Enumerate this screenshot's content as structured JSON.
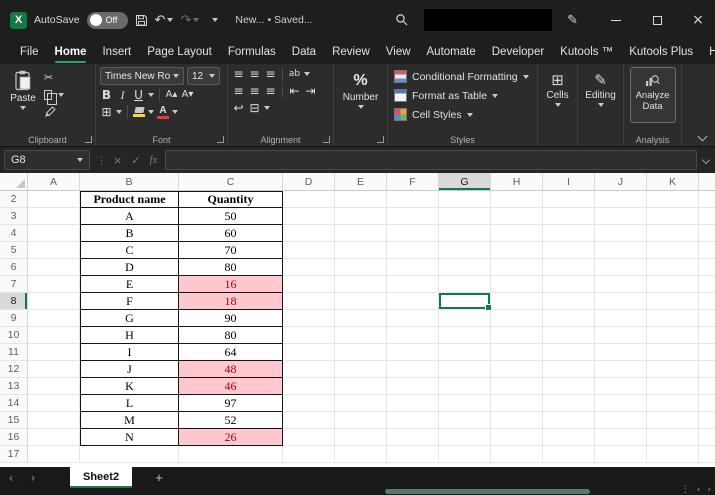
{
  "titlebar": {
    "autosave_label": "AutoSave",
    "autosave_state": "Off",
    "doc_status": "New... • Saved..."
  },
  "menu": {
    "items": [
      "File",
      "Home",
      "Insert",
      "Page Layout",
      "Formulas",
      "Data",
      "Review",
      "View",
      "Automate",
      "Developer",
      "Kutools ™",
      "Kutools Plus",
      "Help"
    ],
    "active": "Home"
  },
  "ribbon": {
    "paste": "Paste",
    "clipboard": "Clipboard",
    "font_name": "Times New Ro",
    "font_size": "12",
    "font": "Font",
    "bold": "B",
    "italic": "I",
    "underline": "U",
    "alignment": "Alignment",
    "number": "Number",
    "conditional_formatting": "Conditional Formatting",
    "format_as_table": "Format as Table",
    "cell_styles": "Cell Styles",
    "styles": "Styles",
    "cells": "Cells",
    "editing": "Editing",
    "analyze_data": "Analyze Data",
    "analysis": "Analysis"
  },
  "formula_bar": {
    "name_box": "G8",
    "fx_label": "fx",
    "formula_value": ""
  },
  "grid": {
    "columns": [
      "A",
      "B",
      "C",
      "D",
      "E",
      "F",
      "G",
      "H",
      "I",
      "J",
      "K"
    ],
    "rows": [
      2,
      3,
      4,
      5,
      6,
      7,
      8,
      9,
      10,
      11,
      12,
      13,
      14,
      15,
      16,
      17
    ],
    "selected_cell": "G8",
    "selected_column": "G",
    "selected_row": 8
  },
  "table": {
    "headers": [
      "Product name",
      "Quantity"
    ],
    "rows": [
      {
        "product": "A",
        "quantity": "50",
        "highlighted": false
      },
      {
        "product": "B",
        "quantity": "60",
        "highlighted": false
      },
      {
        "product": "C",
        "quantity": "70",
        "highlighted": false
      },
      {
        "product": "D",
        "quantity": "80",
        "highlighted": false
      },
      {
        "product": "E",
        "quantity": "16",
        "highlighted": true
      },
      {
        "product": "F",
        "quantity": "18",
        "highlighted": true
      },
      {
        "product": "G",
        "quantity": "90",
        "highlighted": false
      },
      {
        "product": "H",
        "quantity": "80",
        "highlighted": false
      },
      {
        "product": "I",
        "quantity": "64",
        "highlighted": false
      },
      {
        "product": "J",
        "quantity": "48",
        "highlighted": true
      },
      {
        "product": "K",
        "quantity": "46",
        "highlighted": true
      },
      {
        "product": "L",
        "quantity": "97",
        "highlighted": false
      },
      {
        "product": "M",
        "quantity": "52",
        "highlighted": false
      },
      {
        "product": "N",
        "quantity": "26",
        "highlighted": true
      }
    ]
  },
  "sheets": {
    "active": "Sheet2",
    "add_label": "+"
  },
  "icons": {
    "cut": "✂",
    "borders": "⊞",
    "align_lines": "≡",
    "indent_decrease": "⇤",
    "indent_increase": "⇥",
    "wrap_text": "↩",
    "merge_center": "⊟",
    "percent": "%",
    "cells_grid": "⊞",
    "editing_pencil": "✎",
    "pen": "✎",
    "undo": "↶",
    "redo": "↷",
    "grow_font": "A▴",
    "shrink_font": "A▾",
    "orientation": "ab",
    "sheet_nav_left": "‹",
    "sheet_nav_right": "›",
    "scroll_left": "‹",
    "scroll_right": "›",
    "dots": "⋮",
    "cancel": "×",
    "check": "✓",
    "close": "×",
    "excel_logo": "X"
  },
  "colors": {
    "accent_green": "#107C41",
    "share_green": "#169A53",
    "highlight_fill": "#FFC7CE",
    "highlight_text": "#9C0006",
    "selection_border": "#107C41"
  }
}
